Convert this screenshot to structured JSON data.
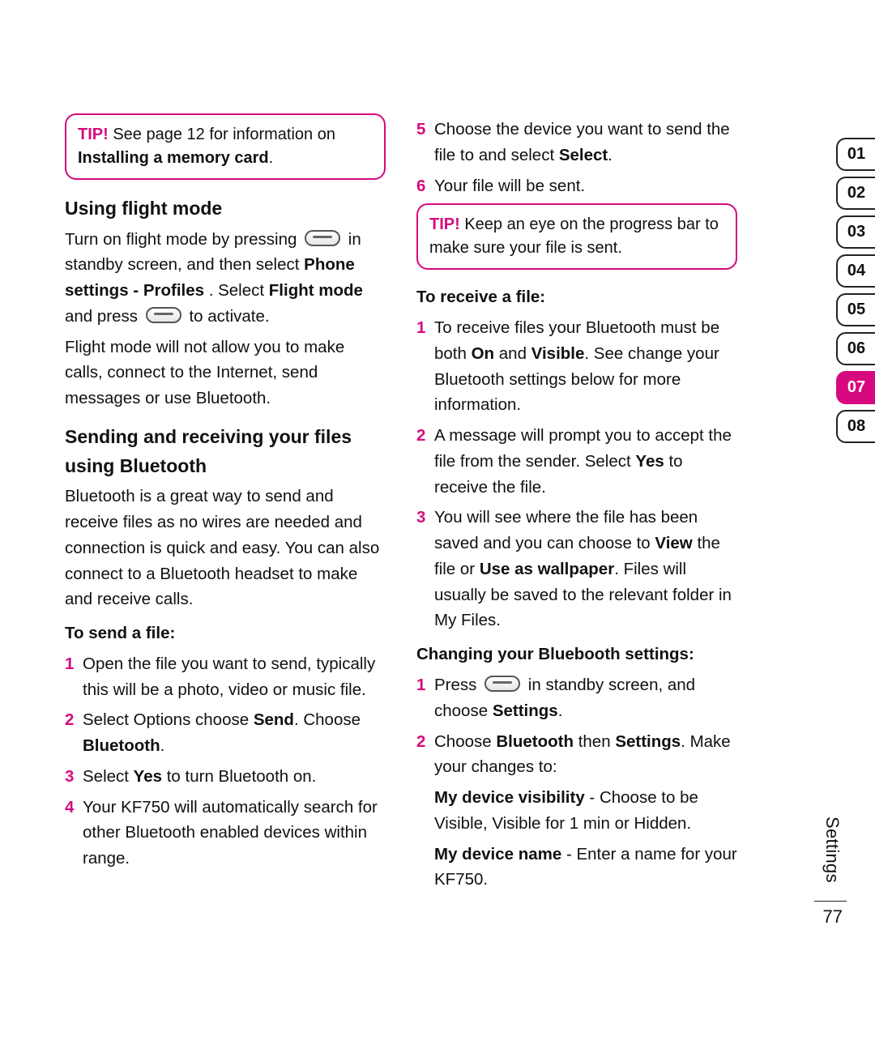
{
  "meta": {
    "side_label": "Settings",
    "page_number": "77",
    "tabs": [
      "01",
      "02",
      "03",
      "04",
      "05",
      "06",
      "07",
      "08"
    ],
    "active_tab_index": 6
  },
  "left": {
    "tip": {
      "label": "TIP!",
      "text_before": " See page 12 for information on ",
      "bold": "Installing a memory card",
      "text_after": "."
    },
    "section1_title": "Using flight mode",
    "section1_para_parts": {
      "a": "Turn on flight mode by pressing ",
      "b": " in standby screen, and then select ",
      "bold_b": "Phone settings - Profiles",
      "c": ". Select ",
      "bold_c": "Flight mode",
      "d": " and press ",
      "e": " to activate."
    },
    "section1_para2": "Flight mode will not allow you to make calls, connect to the Internet, send messages or use Bluetooth.",
    "section2_title": "Sending and receiving your files using Bluetooth",
    "section2_para": "Bluetooth is a great way to send and receive files as no wires are needed and connection is quick and easy. You can also connect to a Bluetooth headset to make and receive calls.",
    "send_head": "To send a file:",
    "send_steps": [
      {
        "n": "1",
        "html": "Open the file you want to send, typically this will be a photo, video or music file."
      },
      {
        "n": "2",
        "html": "Select Options choose <b>Send</b>. Choose <b>Bluetooth</b>."
      },
      {
        "n": "3",
        "html": "Select <b>Yes</b> to turn Bluetooth on."
      },
      {
        "n": "4",
        "html": "Your KF750 will automatically search for other Bluetooth enabled devices within range."
      }
    ]
  },
  "right": {
    "send_steps_cont": [
      {
        "n": "5",
        "html": "Choose the device you want to send the file to and select <b>Select</b>."
      },
      {
        "n": "6",
        "html": "Your file will be sent."
      }
    ],
    "tip": {
      "label": "TIP!",
      "text": " Keep an eye on the progress bar to make sure your file is sent."
    },
    "receive_head": "To receive a file:",
    "receive_steps": [
      {
        "n": "1",
        "html": "To receive files your Bluetooth must be both <b>On</b> and <b>Visible</b>. See change your Bluetooth settings below for more information."
      },
      {
        "n": "2",
        "html": "A message will prompt you to accept the file from the sender. Select <b>Yes</b> to receive the file."
      },
      {
        "n": "3",
        "html": "You will see where the file has been saved and you can choose to <b>View</b> the file or <b>Use as wallpaper</b>. Files will usually be saved to the relevant folder in My Files."
      }
    ],
    "change_head": "Changing your Bluebooth settings:",
    "change_steps": [
      {
        "n": "1",
        "text_before": "Press ",
        "text_after": " in standby screen, and choose ",
        "bold": "Settings",
        "tail": "."
      },
      {
        "n": "2",
        "html": "Choose <b>Bluetooth</b> then <b>Settings</b>. Make your changes to:"
      }
    ],
    "detail1": {
      "bold": "My device visibility",
      "text": " - Choose to be Visible, Visible for 1 min or Hidden."
    },
    "detail2": {
      "bold": "My device name",
      "text": " - Enter a name for your KF750."
    }
  }
}
